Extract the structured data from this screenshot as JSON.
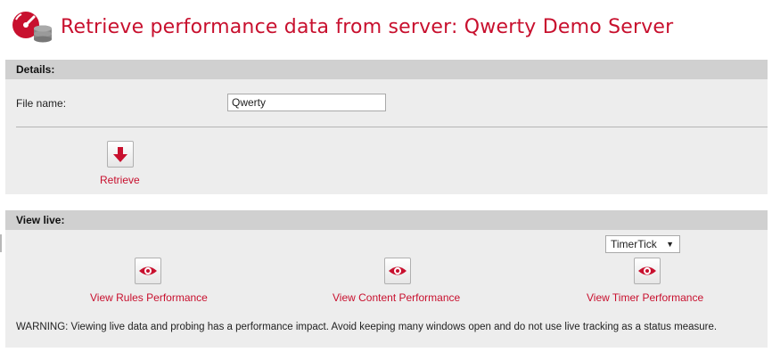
{
  "page": {
    "title": "Retrieve performance data from server: Qwerty Demo Server",
    "icon": "speedometer-database-icon"
  },
  "details": {
    "heading": "Details:",
    "file_name_label": "File name:",
    "file_name_value": "Qwerty",
    "retrieve_label": "Retrieve",
    "retrieve_icon": "download-arrow-icon"
  },
  "view_live": {
    "heading": "View live:",
    "timer_select": {
      "selected": "TimerTick"
    },
    "actions": [
      {
        "label": "View Rules Performance",
        "icon": "eye-icon"
      },
      {
        "label": "View Content Performance",
        "icon": "eye-icon"
      },
      {
        "label": "View Timer Performance",
        "icon": "eye-icon"
      }
    ],
    "warning": "WARNING: Viewing live data and probing has a performance impact. Avoid keeping many windows open and do not use live tracking as a status measure."
  },
  "colors": {
    "accent": "#c8102e",
    "panel_bg": "#ededed",
    "panel_head": "#d0d0d0"
  }
}
